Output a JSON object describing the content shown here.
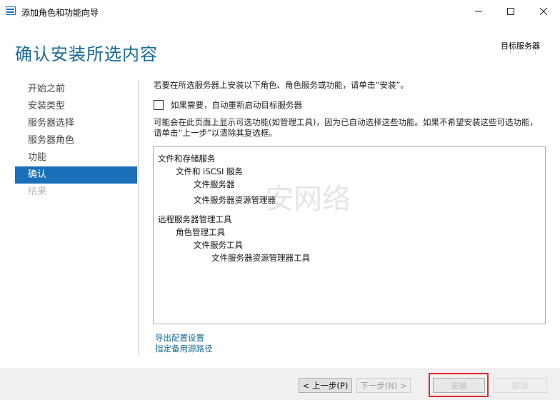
{
  "window": {
    "title": "添加角色和功能向导",
    "minimize_icon": "minimize-icon",
    "maximize_icon": "maximize-icon",
    "close_icon": "close-icon"
  },
  "header": {
    "page_title": "确认安装所选内容",
    "target_server_label": "目标服务器",
    "target_server_name": "· · · ·"
  },
  "nav": {
    "items": [
      {
        "label": "开始之前",
        "state": "normal"
      },
      {
        "label": "安装类型",
        "state": "normal"
      },
      {
        "label": "服务器选择",
        "state": "normal"
      },
      {
        "label": "服务器角色",
        "state": "normal"
      },
      {
        "label": "功能",
        "state": "normal"
      },
      {
        "label": "确认",
        "state": "active"
      },
      {
        "label": "结果",
        "state": "disabled"
      }
    ]
  },
  "content": {
    "intro": "若要在所选服务器上安装以下角色、角色服务或功能，请单击“安装”。",
    "restart_checkbox": {
      "label": "如果需要，自动重新启动目标服务器",
      "checked": false
    },
    "note": "可能会在此页面上显示可选功能(如管理工具)，因为已自动选择这些功能。如果不希望安装这些可选功能，请单击“上一步”以清除其复选框。",
    "watermark": "安网络",
    "features": [
      {
        "text": "文件和存储服务",
        "level": 0
      },
      {
        "text": "文件和 iSCSI 服务",
        "level": 1
      },
      {
        "text": "文件服务器",
        "level": 2
      },
      {
        "text": "文件服务器资源管理器",
        "level": 2
      },
      {
        "text": "远程服务器管理工具",
        "level": 0
      },
      {
        "text": "角色管理工具",
        "level": 1
      },
      {
        "text": "文件服务工具",
        "level": 2
      },
      {
        "text": "文件服务器资源管理器工具",
        "level": 3
      }
    ],
    "links": {
      "export": "导出配置设置",
      "alternate_source": "指定备用源路径"
    }
  },
  "footer": {
    "prev": "< 上一步(P)",
    "next": "下一步(N) >",
    "install": "安装",
    "cancel": "取消"
  },
  "colors": {
    "accent": "#1a70b8",
    "title": "#1a6b96",
    "highlight": "#e12b2b"
  }
}
